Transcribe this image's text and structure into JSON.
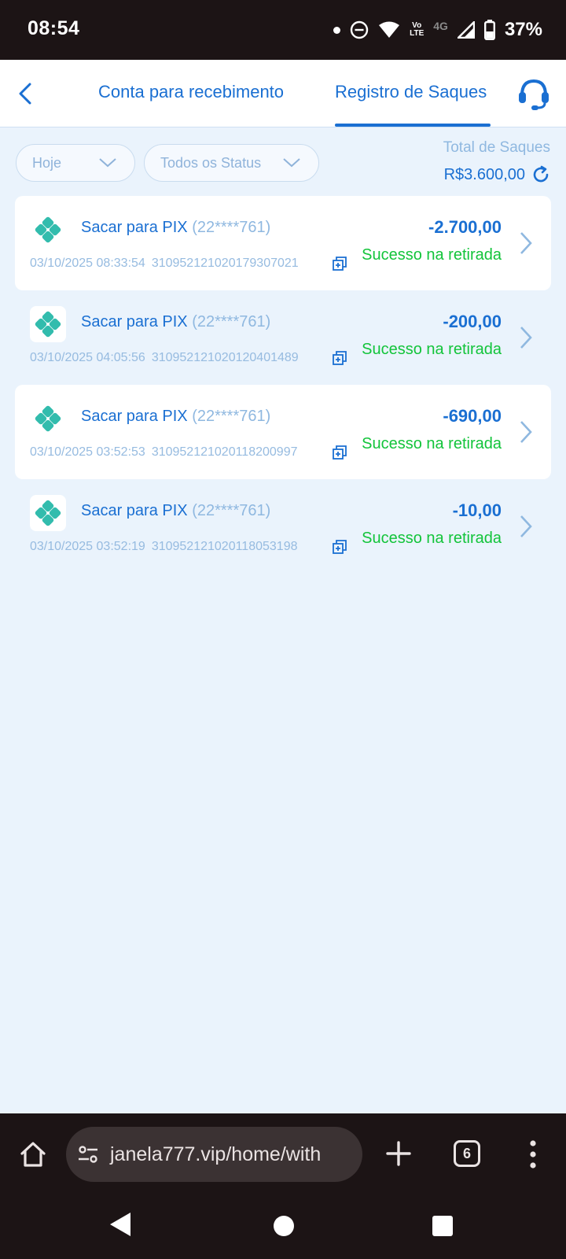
{
  "status_bar": {
    "time": "08:54",
    "network_volte_top": "Vo",
    "network_volte_bottom": "LTE",
    "network_type": "4G",
    "battery": "37%"
  },
  "header": {
    "tabs": [
      {
        "label": "Conta para recebimento",
        "active": false
      },
      {
        "label": "Registro de Saques",
        "active": true
      }
    ],
    "accent_color": "#1a6fd2"
  },
  "filters": {
    "date": "Hoje",
    "status": "Todos os Status"
  },
  "total": {
    "label": "Total de Saques",
    "value": "R$3.600,00"
  },
  "withdrawals": [
    {
      "title": "Sacar para PIX",
      "account": "(22****761)",
      "datetime": "03/10/2025 08:33:54",
      "code": "310952121020179307021",
      "amount": "-2.700,00",
      "status": "Sucesso na retirada"
    },
    {
      "title": "Sacar para PIX",
      "account": "(22****761)",
      "datetime": "03/10/2025 04:05:56",
      "code": "310952121020120401489",
      "amount": "-200,00",
      "status": "Sucesso na retirada"
    },
    {
      "title": "Sacar para PIX",
      "account": "(22****761)",
      "datetime": "03/10/2025 03:52:53",
      "code": "310952121020118200997",
      "amount": "-690,00",
      "status": "Sucesso na retirada"
    },
    {
      "title": "Sacar para PIX",
      "account": "(22****761)",
      "datetime": "03/10/2025 03:52:19",
      "code": "310952121020118053198",
      "amount": "-10,00",
      "status": "Sucesso na retirada"
    }
  ],
  "colors": {
    "success": "#12c43a",
    "pix": "#32bcad",
    "background": "#eaf3fc"
  },
  "browser": {
    "url": "janela777.vip/home/with",
    "tab_count": "6"
  }
}
